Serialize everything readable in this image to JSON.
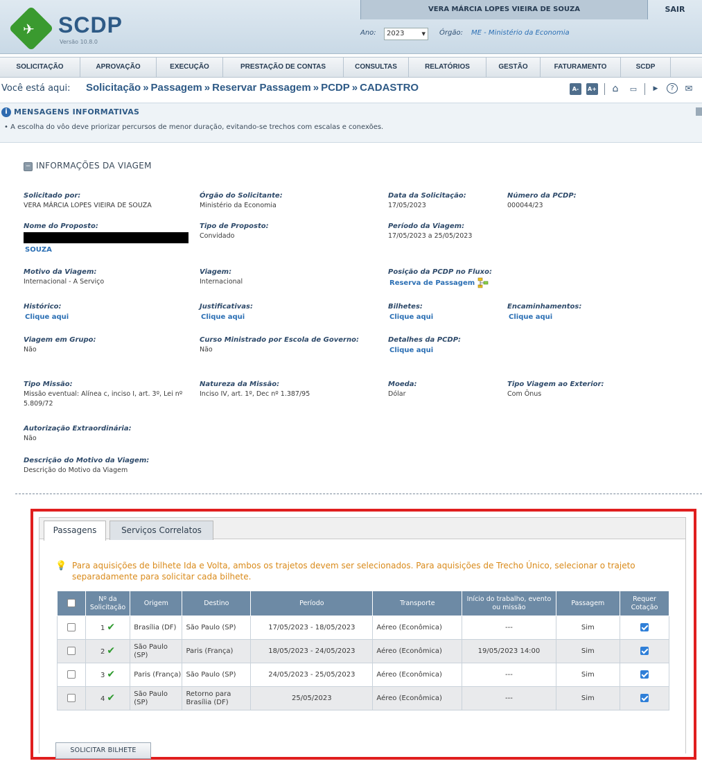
{
  "header": {
    "logo_text": "SCDP",
    "version": "Versão 10.8.0",
    "user_name": "VERA MÁRCIA LOPES VIEIRA DE SOUZA",
    "logout_label": "SAIR",
    "year_label": "Ano:",
    "year_value": "2023",
    "org_label": "Órgão:",
    "org_value": "ME - Ministério da Economia"
  },
  "menu": [
    "SOLICITAÇÃO",
    "APROVAÇÃO",
    "EXECUÇÃO",
    "PRESTAÇÃO DE CONTAS",
    "CONSULTAS",
    "RELATÓRIOS",
    "GESTÃO",
    "FATURAMENTO",
    "SCDP"
  ],
  "breadcrumb": {
    "prefix": "Você está aqui:",
    "items": [
      "Solicitação",
      "Passagem",
      "Reservar Passagem",
      "PCDP",
      "CADASTRO"
    ],
    "separator": "»"
  },
  "tools": {
    "font_decrease": "A-",
    "font_increase": "A+",
    "home_icon": "⌂",
    "chat_icon": "▭",
    "video_icon": "▶",
    "help_icon": "?",
    "mail_icon": "✉"
  },
  "messages": {
    "title": "MENSAGENS INFORMATIVAS",
    "items": [
      "A escolha do vôo deve priorizar percursos de menor duração, evitando-se trechos com escalas e conexões."
    ]
  },
  "trip": {
    "title": "INFORMAÇÕES DA VIAGEM",
    "solicitado_label": "Solicitado por:",
    "solicitado_value": "VERA MÁRCIA LOPES VIEIRA DE SOUZA",
    "orgao_label": "Órgão do Solicitante:",
    "orgao_value": "Ministério da Economia",
    "data_label": "Data da Solicitação:",
    "data_value": "17/05/2023",
    "numero_label": "Número da PCDP:",
    "numero_value": "000044/23",
    "nome_label": "Nome do Proposto:",
    "nome_value": "SOUZA",
    "tipo_label": "Tipo de Proposto:",
    "tipo_value": "Convidado",
    "periodo_label": "Período da Viagem:",
    "periodo_value": "17/05/2023 a 25/05/2023",
    "motivo_label": "Motivo da Viagem:",
    "motivo_value": "Internacional - A Serviço",
    "viagem_label": "Viagem:",
    "viagem_value": "Internacional",
    "posicao_label": "Posição da PCDP no Fluxo:",
    "posicao_value": "Reserva de Passagem",
    "historico_label": "Histórico:",
    "justificativas_label": "Justificativas:",
    "bilhetes_label": "Bilhetes:",
    "encaminhamentos_label": "Encaminhamentos:",
    "link_text": "Clique aqui",
    "grupo_label": "Viagem em Grupo:",
    "grupo_value": "Não",
    "curso_label": "Curso Ministrado por Escola de Governo:",
    "curso_value": "Não",
    "detalhes_label": "Detalhes da PCDP:",
    "missao_label": "Tipo Missão:",
    "missao_value": "Missão eventual: Alínea c, inciso I, art. 3º, Lei nº 5.809/72",
    "natureza_label": "Natureza da Missão:",
    "natureza_value": "Inciso IV, art. 1º, Dec nº 1.387/95",
    "moeda_label": "Moeda:",
    "moeda_value": "Dólar",
    "exterior_label": "Tipo Viagem ao Exterior:",
    "exterior_value": "Com Ônus",
    "autorizacao_label": "Autorização Extraordinária:",
    "autorizacao_value": "Não",
    "descricao_label": "Descrição do Motivo da Viagem:",
    "descricao_value": "Descrição do Motivo da Viagem"
  },
  "tabs": [
    "Passagens",
    "Serviços Correlatos"
  ],
  "tip": "Para aquisições de bilhete Ida e Volta, ambos os trajetos devem ser selecionados. Para aquisições de Trecho Único, selecionar o trajeto separadamente para solicitar cada bilhete.",
  "table": {
    "headers": [
      "Nº da Solicitação",
      "Origem",
      "Destino",
      "Período",
      "Transporte",
      "Início do trabalho, evento ou missão",
      "Passagem",
      "Requer Cotação"
    ],
    "rows": [
      {
        "num": "1",
        "origem": "Brasília (DF)",
        "destino": "São Paulo (SP)",
        "periodo": "17/05/2023 - 18/05/2023",
        "transporte": "Aéreo (Econômica)",
        "inicio": "---",
        "passagem": "Sim",
        "cotacao": true
      },
      {
        "num": "2",
        "origem": "São Paulo (SP)",
        "destino": "Paris (França)",
        "periodo": "18/05/2023 - 24/05/2023",
        "transporte": "Aéreo (Econômica)",
        "inicio": "19/05/2023 14:00",
        "passagem": "Sim",
        "cotacao": true
      },
      {
        "num": "3",
        "origem": "Paris (França)",
        "destino": "São Paulo (SP)",
        "periodo": "24/05/2023 - 25/05/2023",
        "transporte": "Aéreo (Econômica)",
        "inicio": "---",
        "passagem": "Sim",
        "cotacao": true
      },
      {
        "num": "4",
        "origem": "São Paulo (SP)",
        "destino": "Retorno para Brasília (DF)",
        "periodo": "25/05/2023",
        "transporte": "Aéreo (Econômica)",
        "inicio": "---",
        "passagem": "Sim",
        "cotacao": true
      }
    ]
  },
  "actions": {
    "request_ticket": "SOLICITAR BILHETE"
  },
  "colors": {
    "accent": "#2e5a86",
    "link": "#2b6fb4",
    "table_header": "#6d8aa5",
    "highlight_border": "#e01e1e",
    "tip": "#d98a1a",
    "ok": "#2e9a2e"
  }
}
